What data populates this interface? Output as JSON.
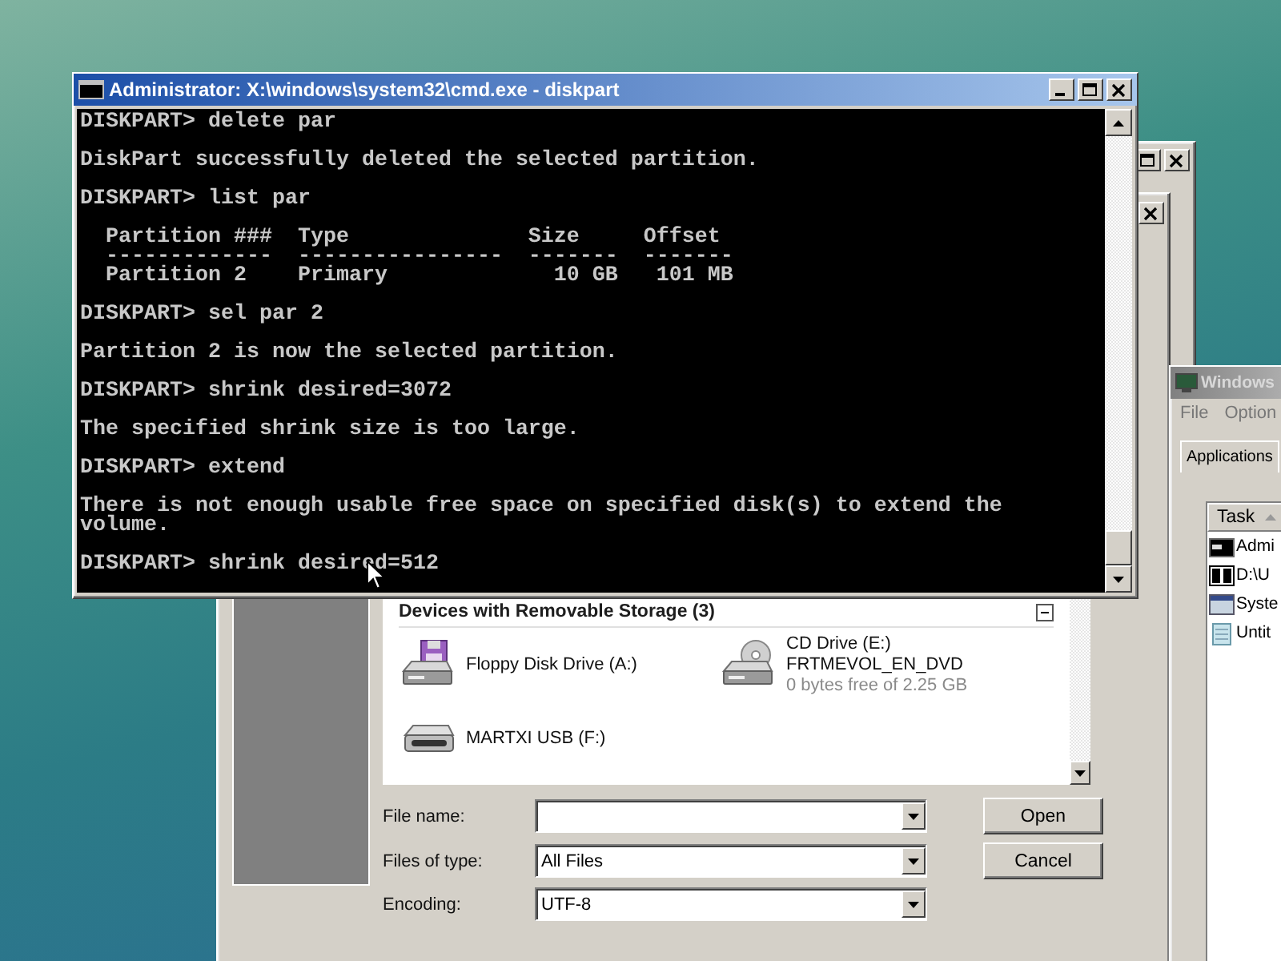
{
  "console_window": {
    "title": "Administrator: X:\\windows\\system32\\cmd.exe - diskpart",
    "blocks": [
      [
        "DISKPART> delete par"
      ],
      [
        "DiskPart successfully deleted the selected partition."
      ],
      [
        "DISKPART> list par"
      ],
      [
        "  Partition ###  Type              Size     Offset",
        "  -------------  ----------------  -------  -------",
        "  Partition 2    Primary             10 GB   101 MB"
      ],
      [
        "DISKPART> sel par 2"
      ],
      [
        "Partition 2 is now the selected partition."
      ],
      [
        "DISKPART> shrink desired=3072"
      ],
      [
        "The specified shrink size is too large."
      ],
      [
        "DISKPART> extend"
      ],
      [
        "There is not enough usable free space on specified disk(s) to extend the",
        "volume."
      ],
      [
        "DISKPART> shrink desired=512"
      ]
    ]
  },
  "open_dialog": {
    "group": {
      "title": "Devices with Removable Storage (3)",
      "expanded": true
    },
    "devices": [
      {
        "kind": "floppy",
        "name": "Floppy Disk Drive (A:)"
      },
      {
        "kind": "cd",
        "name": "CD Drive (E:)",
        "label": "FRTMEVOL_EN_DVD",
        "space": "0 bytes free of 2.25 GB"
      },
      {
        "kind": "usb",
        "name": "MARTXI USB (F:)"
      }
    ],
    "fields": [
      {
        "label": "File name:"
      },
      {
        "label": "Files of type:",
        "value": "All Files"
      },
      {
        "label": "Encoding:",
        "value": "UTF-8"
      }
    ],
    "buttons": [
      "Open",
      "Cancel"
    ]
  },
  "task_manager": {
    "title": "Windows",
    "menu": [
      "File",
      "Option"
    ],
    "tabs": [
      {
        "label": "Applications",
        "selected": true
      }
    ],
    "column": "Task",
    "tasks": [
      {
        "kind": "console",
        "name": "Admi"
      },
      {
        "kind": "archive",
        "name": "D:\\U"
      },
      {
        "kind": "window",
        "name": "Syste"
      },
      {
        "kind": "notepad",
        "name": "Untit"
      }
    ]
  }
}
